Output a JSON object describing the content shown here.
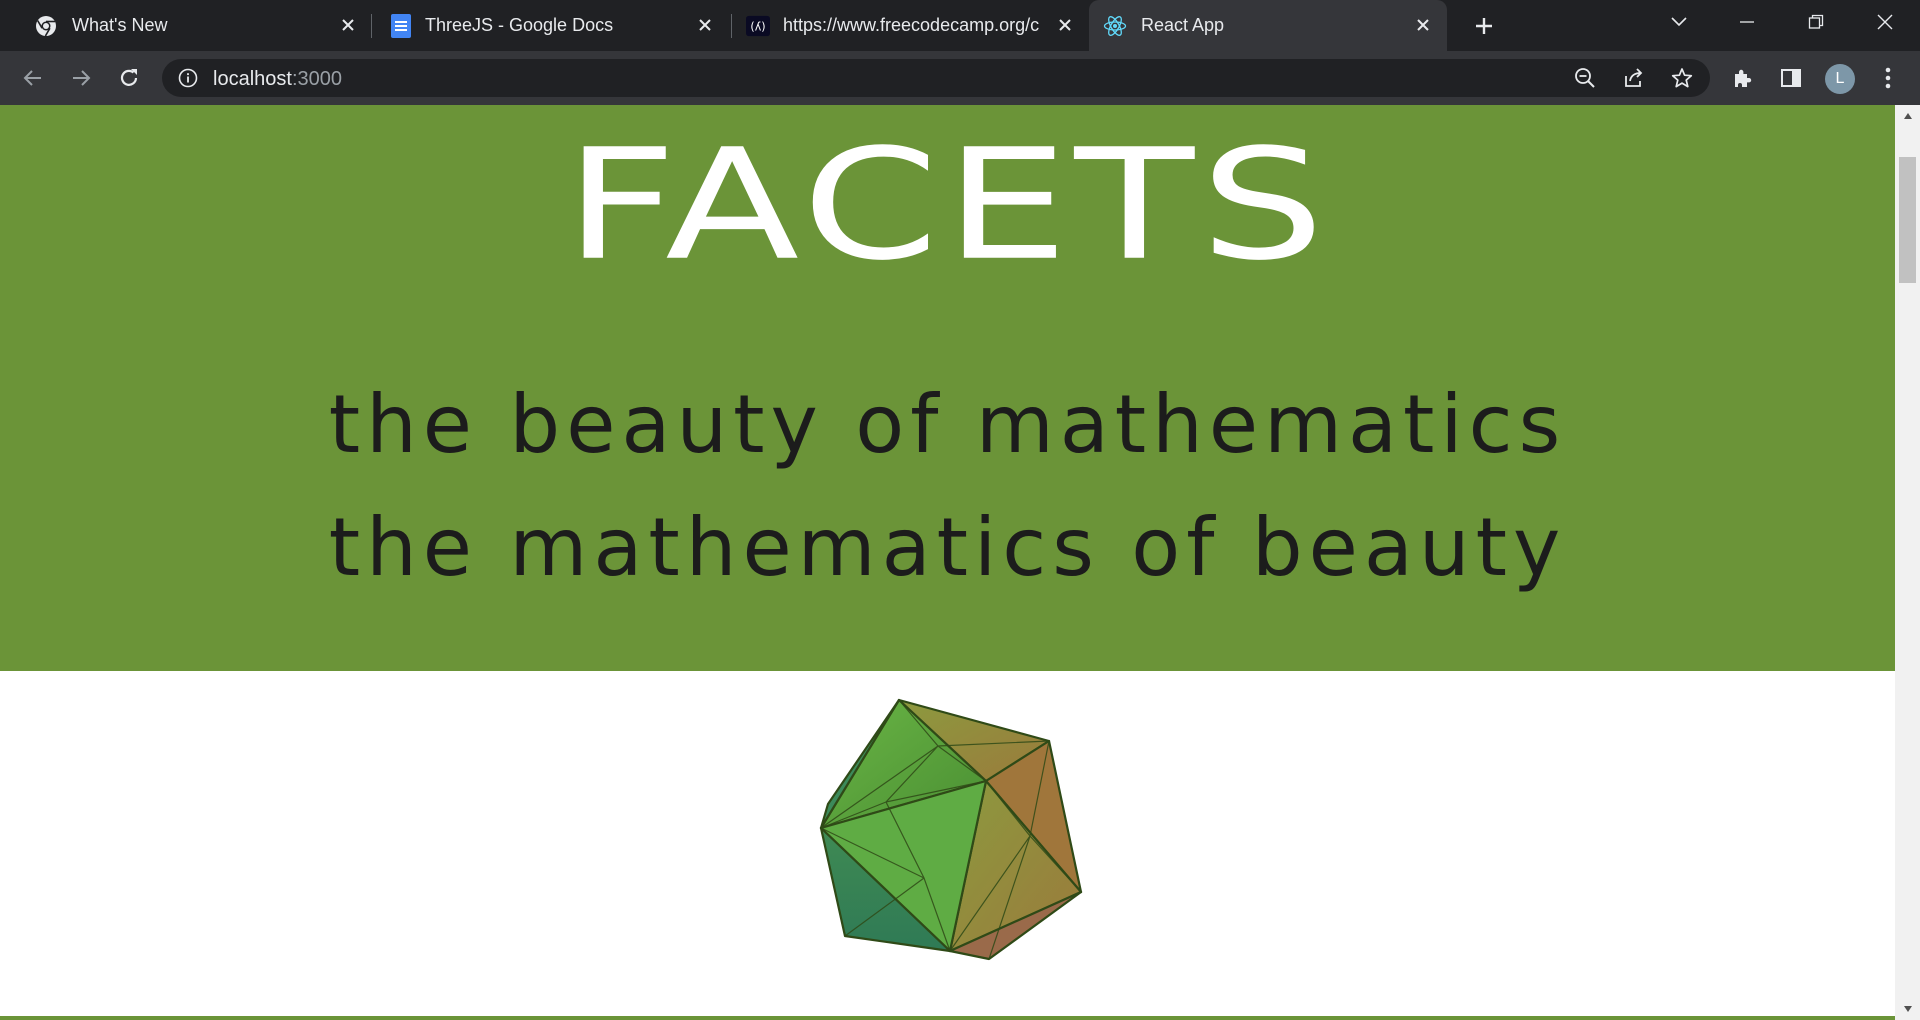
{
  "browser": {
    "tabs": [
      {
        "title": "What's New",
        "icon": "chrome-icon"
      },
      {
        "title": "ThreeJS - Google Docs",
        "icon": "google-docs-icon"
      },
      {
        "title": "https://www.freecodecamp.org/c",
        "icon": "freecodecamp-icon"
      },
      {
        "title": "React App",
        "icon": "react-icon",
        "active": true
      }
    ],
    "address": {
      "host": "localhost",
      "port": ":3000"
    },
    "profile_initial": "L"
  },
  "page": {
    "title": "FACETS",
    "tagline_1": "the beauty of mathematics",
    "tagline_2": "the mathematics of beauty"
  },
  "colors": {
    "hero_bg": "#6b9438",
    "title_text": "#ffffff",
    "tagline_text": "#1c1c1c",
    "shape_green": "#5aa23c",
    "shape_edge": "#2f4a17"
  }
}
